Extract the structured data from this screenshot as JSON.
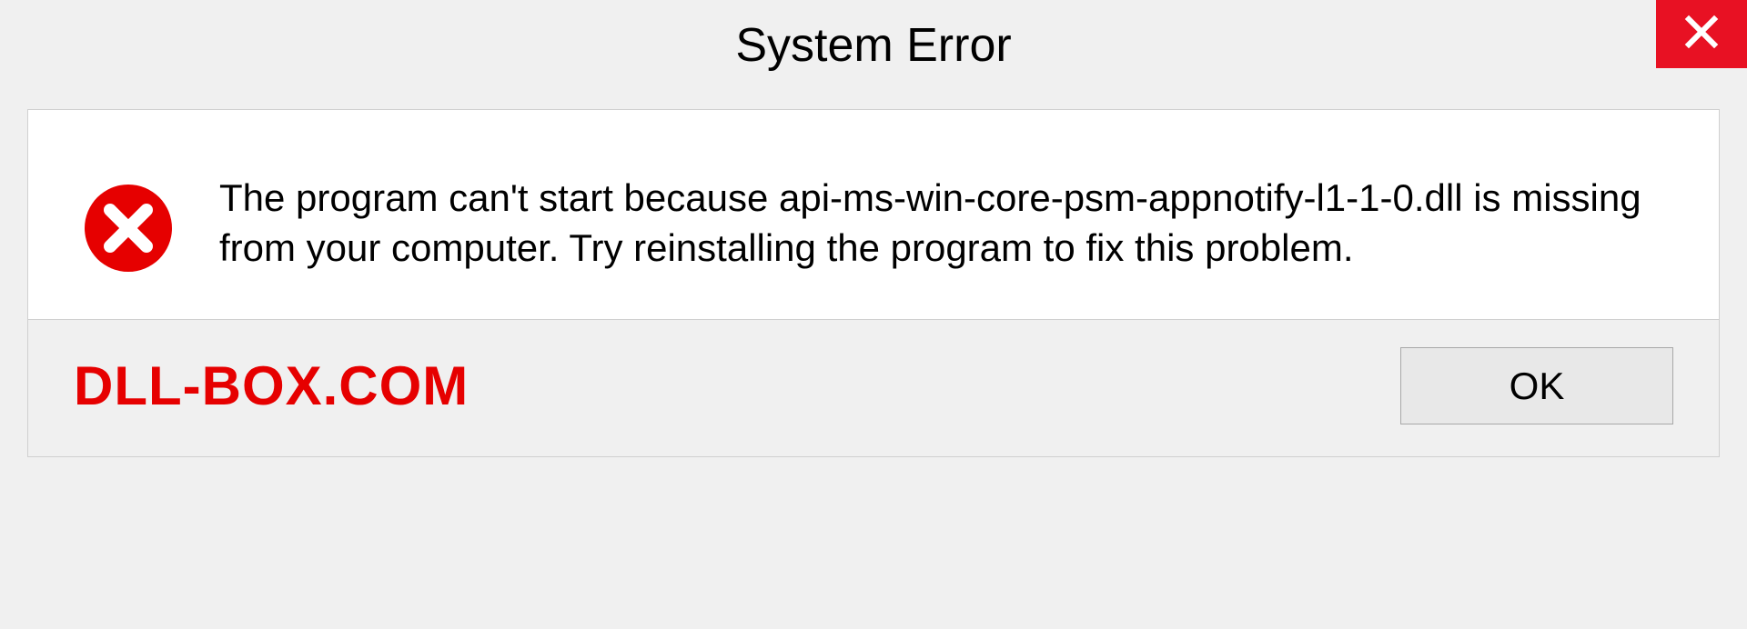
{
  "titlebar": {
    "title": "System Error"
  },
  "content": {
    "message": "The program can't start because api-ms-win-core-psm-appnotify-l1-1-0.dll is missing from your computer. Try reinstalling the program to fix this problem."
  },
  "footer": {
    "watermark": "DLL-BOX.COM",
    "ok_label": "OK"
  },
  "colors": {
    "close_bg": "#e81123",
    "error_icon": "#e60000",
    "watermark": "#e60000"
  }
}
